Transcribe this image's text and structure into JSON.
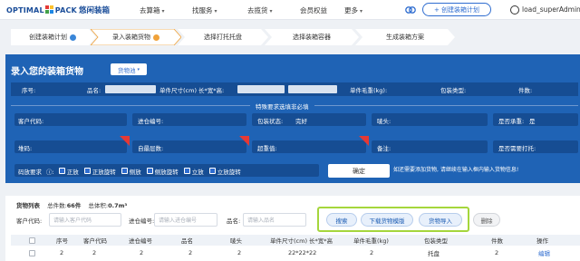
{
  "nav": {
    "logo_left": "OPTIMAL",
    "logo_right": "PACK",
    "logo_cn": "悠闲装箱",
    "items": [
      "去算箱",
      "找服务",
      "去揽货",
      "会员权益",
      "更多"
    ],
    "new_plan": "+ 创建装箱计划",
    "user": "load_superAdmin"
  },
  "steps": [
    {
      "label": "创建装箱计划",
      "status": "done"
    },
    {
      "label": "录入装箱货物",
      "status": "current"
    },
    {
      "label": "选择打托托盘",
      "status": "todo"
    },
    {
      "label": "选择装箱容器",
      "status": "todo"
    },
    {
      "label": "生成装箱方案",
      "status": "todo"
    }
  ],
  "form": {
    "title": "录入您的装箱货物",
    "pool_button": "货物池",
    "header_fields": [
      "序号:",
      "品名:",
      "单件尺寸(cm) 长*宽*高:",
      "单件毛重(kg):",
      "包装类型:",
      "件数:"
    ],
    "special_section": "特殊要求选填非必填",
    "row1": {
      "customer_code": "客户代码:",
      "entry_no": "进仓编号:",
      "package_status": "包装状态:",
      "package_status_value": "完好",
      "mark": "唛头:",
      "bearing": "是否承重:",
      "bearing_value": "是"
    },
    "row2": {
      "stack": "堆码:",
      "self_layers": "自最层数:",
      "overweight": "超重值:",
      "remark": "备注:",
      "need_pallet": "是否需要打托:"
    },
    "placement_label": "码放要求",
    "placements": [
      "正放",
      "正放旋转",
      "侧放",
      "侧放旋转",
      "立放",
      "立放旋转"
    ],
    "confirm": "确定",
    "hint": "如还需要添加货物, 请继续在输入框内输入货物信息!"
  },
  "list": {
    "label": "货物列表",
    "total_pieces_label": "总件数:",
    "total_pieces": "66件",
    "total_volume_label": "总体积:",
    "total_volume": "0.7m³",
    "search": {
      "customer_code_label": "客户代码:",
      "customer_code_placeholder": "请输入客户代码",
      "entry_no_label": "进仓编号:",
      "entry_no_placeholder": "请输入进仓编号",
      "name_label": "品名:",
      "name_placeholder": "请输入品名"
    },
    "buttons": {
      "search": "搜索",
      "download_template": "下载货物模版",
      "import": "货物导入",
      "delete": "删除"
    },
    "columns": [
      "序号",
      "客户代码",
      "进仓编号",
      "品名",
      "唛头",
      "单件尺寸(cm) 长*宽*高",
      "单件毛重(kg)",
      "包装类型",
      "件数",
      "操作"
    ],
    "rows": [
      {
        "no": "2",
        "customer": "2",
        "entry": "2",
        "name": "2",
        "mark": "2",
        "size": "22*22*22",
        "weight": "2",
        "pack": "托盘",
        "qty": "2",
        "op": "编辑"
      }
    ]
  },
  "colors": {
    "brand": "#1a4d99",
    "panel": "#1f63b5",
    "accent": "#2f6dd0",
    "highlight": "#a5d63c"
  }
}
